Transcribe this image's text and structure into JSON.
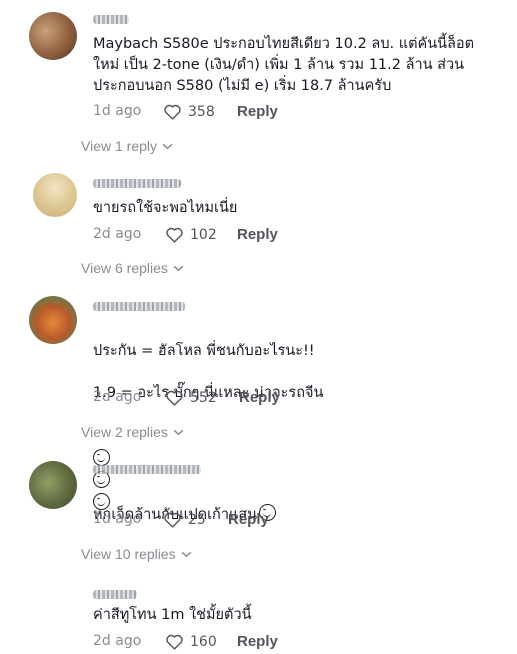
{
  "comments": [
    {
      "text": "Maybach S580e ประกอบไทยสีเดียว 10.2 ลบ. แต่คันนี้ล็อต\nใหม่ เป็น 2-tone (เงิน/ดำ) เพิ่ม 1 ล้าน รวม 11.2 ล้าน ส่วน\nประกอบนอก S580 (ไม่มี e) เริ่ม 18.7 ล้านครับ",
      "date": "1d ago",
      "likes": "358",
      "reply": "Reply",
      "view_replies": "View 1 reply"
    },
    {
      "text": "ขายรถใช้จะพอไหมเนี่ย",
      "date": "2d ago",
      "likes": "102",
      "reply": "Reply",
      "view_replies": "View 6 replies"
    },
    {
      "text_line1": "ประกัน = ฮัลโหล พี่ชนกับอะไรนะ!!",
      "text_line2": "1.9 = อะไร บั๊กๆ นี่แหละ น่าจะรถจีน",
      "emoji_count": 3,
      "emoji": "grinning-squinting-face",
      "date": "2d ago",
      "likes": "552",
      "reply": "Reply",
      "view_replies": "View 2 replies"
    },
    {
      "text": "หกเจ็ดล้านกับแปดเก้าแสน",
      "emoji": "grinning-face",
      "date": "1d ago",
      "likes": "25",
      "reply": "Reply",
      "view_replies": "View 10 replies"
    },
    {
      "text": "ค่าสีทูโทน 1m ใช่มั้ยตัวนี้",
      "date": "2d ago",
      "likes": "160",
      "reply": "Reply"
    }
  ],
  "colors": {
    "text": "#161823",
    "muted": "#8a8b91",
    "action": "#54555c"
  }
}
